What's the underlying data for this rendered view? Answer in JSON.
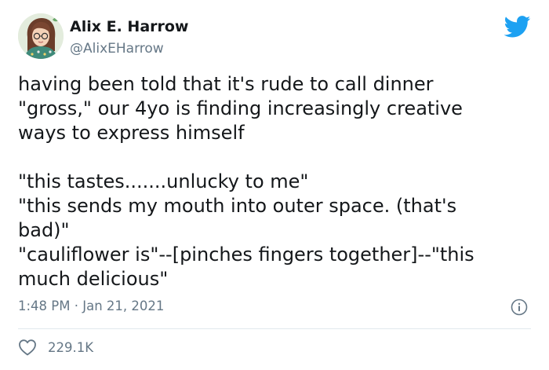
{
  "author": {
    "display_name": "Alix E. Harrow",
    "handle": "@AlixEHarrow"
  },
  "tweet": {
    "paragraph1": [
      "having been told that it's rude to call dinner",
      "\"gross,\" our 4yo is finding increasingly creative",
      "ways to express himself"
    ],
    "paragraph2": [
      "\"this tastes.......unlucky to me\"",
      "\"this sends my mouth into outer space. (that's",
      "bad)\"",
      "\"cauliflower is\"--[pinches fingers together]--\"this",
      "much delicious\""
    ]
  },
  "meta": {
    "time": "1:48 PM",
    "separator": "·",
    "date": "Jan 21, 2021"
  },
  "engagement": {
    "likes": "229.1K"
  },
  "icons": {
    "platform": "twitter-bird-icon",
    "info": "info-icon",
    "like": "heart-icon"
  },
  "colors": {
    "twitter_blue": "#1da1f2",
    "secondary_text": "#657786",
    "primary_text": "#14171a",
    "divider": "#e1e8ed"
  }
}
